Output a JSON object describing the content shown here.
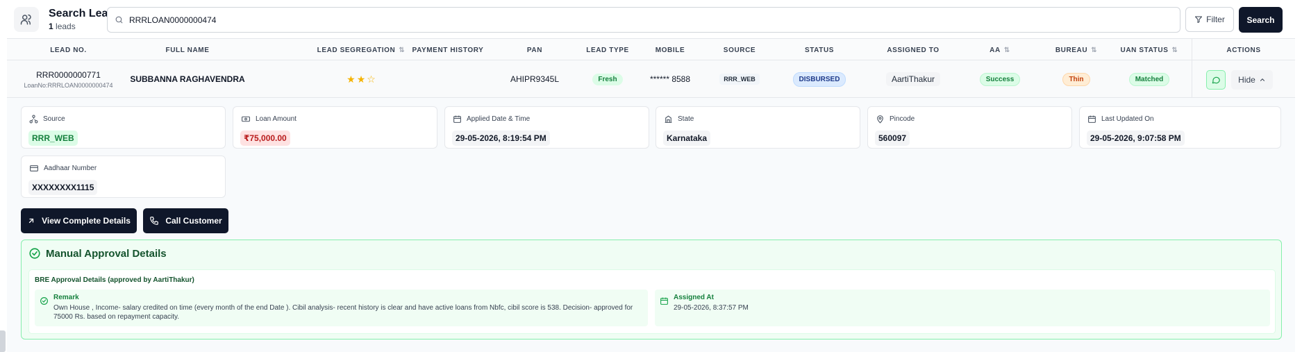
{
  "header": {
    "title": "Search Leads",
    "count": "1",
    "count_suffix": " leads",
    "search_value": "RRRLOAN0000000474",
    "filter_label": "Filter",
    "search_label": "Search"
  },
  "columns": {
    "lead_no": "LEAD NO.",
    "full_name": "FULL NAME",
    "lead_segregation": "LEAD SEGREGATION",
    "payment_history": "PAYMENT HISTORY",
    "pan": "PAN",
    "lead_type": "LEAD TYPE",
    "mobile": "MOBILE",
    "source": "SOURCE",
    "status": "STATUS",
    "assigned_to": "ASSIGNED TO",
    "aa": "AA",
    "bureau": "BUREAU",
    "uan_status": "UAN STATUS",
    "actions": "ACTIONS"
  },
  "row": {
    "lead_no": "RRR0000000771",
    "loan_no": "LoanNo:RRRLOAN0000000474",
    "full_name": "SUBBANNA RAGHAVENDRA",
    "rating": 2,
    "rating_max": 3,
    "payment_history": "",
    "pan": "AHIPR9345L",
    "lead_type": "Fresh",
    "mobile": "****** 8588",
    "source": "RRR_WEB",
    "status": "DISBURSED",
    "assigned_to": "AartiThakur",
    "aa": "Success",
    "bureau": "Thin",
    "uan_status": "Matched",
    "hide_label": "Hide"
  },
  "details": {
    "source_label": "Source",
    "source_value": "RRR_WEB",
    "loan_amount_label": "Loan Amount",
    "loan_amount_value": "₹75,000.00",
    "applied_label": "Applied Date & Time",
    "applied_value": "29-05-2026, 8:19:54 PM",
    "state_label": "State",
    "state_value": "Karnataka",
    "pincode_label": "Pincode",
    "pincode_value": "560097",
    "updated_label": "Last Updated On",
    "updated_value": "29-05-2026, 9:07:58 PM",
    "aadhaar_label": "Aadhaar Number",
    "aadhaar_value": "XXXXXXXX1115"
  },
  "buttons": {
    "view_details": "View Complete Details",
    "call_customer": "Call Customer"
  },
  "approval": {
    "title": "Manual Approval Details",
    "subtitle": "BRE Approval Details (approved by AartiThakur)",
    "remark_label": "Remark",
    "remark_text": "Own House , Income- salary credited on time (every month of the end Date ). Cibil analysis- recent history is clear and have active loans from Nbfc, cibil score is 538. Decision- approved for 75000 Rs. based on repayment capacity.",
    "assigned_label": "Assigned At",
    "assigned_value": "29-05-2026, 8:37:57 PM"
  },
  "colors": {
    "primary": "#0f172a",
    "success": "#15803d",
    "warning": "#c2410c",
    "info": "#1e3a8a"
  },
  "icons": {
    "header": "users-icon",
    "search": "search-icon",
    "filter": "filter-icon",
    "sort": "sort-icon",
    "chat": "chat-icon",
    "hide": "chevron-up-icon"
  }
}
